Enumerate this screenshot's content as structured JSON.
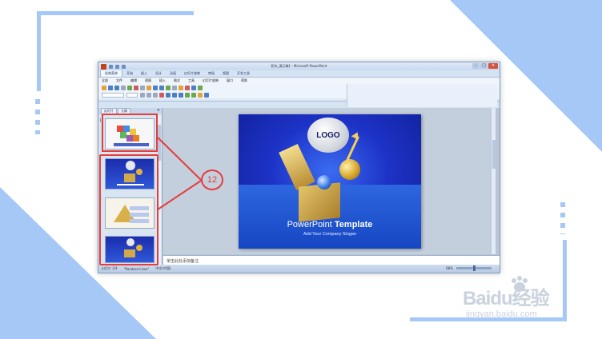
{
  "window": {
    "title": "积木_演示稿1 - Microsoft PowerPoint",
    "controls": [
      "–",
      "□",
      "✕"
    ]
  },
  "ribbon": {
    "tabs": [
      "经典菜单",
      "开始",
      "插入",
      "设计",
      "动画",
      "幻灯片放映",
      "审阅",
      "视图",
      "开发工具"
    ],
    "menu": [
      "全部",
      "文件",
      "编辑",
      "视图",
      "插入",
      "格式",
      "工具",
      "幻灯片放映",
      "窗口",
      "帮助"
    ]
  },
  "left_pane": {
    "tabs": [
      "幻灯片",
      "大纲"
    ],
    "close": "×",
    "thumb_numbers": [
      "1",
      "2",
      "3",
      "4"
    ]
  },
  "slide": {
    "logo": "LOGO",
    "title_light": "PowerPoint ",
    "title_bold": "Template",
    "subtitle": "Add Your Company Slogan"
  },
  "notes": {
    "placeholder": "单击此处添加备注"
  },
  "status": {
    "slide": "幻灯片 2/4",
    "theme": "\"Pandora's box\"",
    "lang": "中文(中国)",
    "zoom": "68%"
  },
  "annotation": {
    "label": "12"
  },
  "watermark": {
    "main": "Baidu经验",
    "sub": "jingyan.baidu.com"
  },
  "colors": {
    "accent_blue": "#a5c8f6",
    "highlight_red": "#e53c3c",
    "slide_blue": "#1d33c7"
  }
}
